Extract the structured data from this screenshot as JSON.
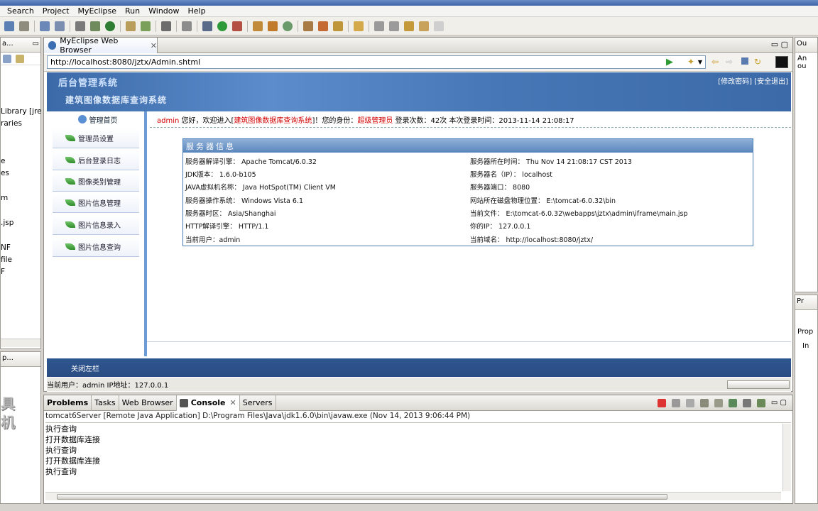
{
  "app": {
    "menu": [
      "Search",
      "Project",
      "MyEclipse",
      "Run",
      "Window",
      "Help"
    ]
  },
  "left_panel": {
    "tab_label": "a...",
    "items": [
      "Library [jre",
      "raries",
      "e",
      "es",
      "m",
      ".jsp",
      "NF",
      "file",
      "F"
    ],
    "bottom_tab_label": "p..."
  },
  "right_panel": {
    "tab1_label": "Ou",
    "tab1_content": "An ou",
    "tab2_label": "Pr",
    "tab2_sub": "Prop",
    "tab2_item": "In"
  },
  "browser": {
    "tab_label": "MyEclipse Web Browser",
    "url": "http://localhost:8080/jztx/Admin.shtml"
  },
  "site": {
    "logo": "后台管理系统",
    "subtitle": "建筑图像数据库查询系统",
    "header_links": "[修改密码] [安全退出]",
    "sidebar_home": "管理首页",
    "menu_items": [
      "管理员设置",
      "后台登录日志",
      "图像类别管理",
      "图片信息管理",
      "图片信息录入",
      "图片信息查询"
    ],
    "welcome": {
      "user": "admin",
      "text1": " 您好，欢迎进入[",
      "system": "建筑图像数据库查询系统",
      "text2": "]！您的身份：",
      "role": "超级管理员",
      "text3": " 登录次数：42次 本次登录时间：2013-11-14 21:08:17"
    },
    "info_title": "服务器信息",
    "info_left": [
      "服务器解译引擎： Apache Tomcat/6.0.32",
      "JDK版本： 1.6.0-b105",
      "JAVA虚拟机名称： Java HotSpot(TM) Client VM",
      "服务器操作系统： Windows Vista 6.1",
      "服务器时区： Asia/Shanghai",
      "HTTP解译引擎： HTTP/1.1",
      "当前用户：admin"
    ],
    "info_right": [
      "服务器所在时间： Thu Nov 14 21:08:17 CST 2013",
      "服务器名（IP）： localhost",
      "服务器端口： 8080",
      "网站所在磁盘物理位置： E:\\tomcat-6.0.32\\bin",
      "当前文件： E:\\tomcat-6.0.32\\webapps\\jztx\\admin\\iframe\\main.jsp",
      "你的IP： 127.0.0.1",
      "当前域名： http://localhost:8080/jztx/"
    ],
    "close_sidebar": "关闭左栏",
    "status_text": "当前用户：admin  IP地址：127.0.0.1"
  },
  "console": {
    "tabs": [
      "Problems",
      "Tasks",
      "Web Browser",
      "Console",
      "Servers"
    ],
    "active_tab": "Console",
    "description": "tomcat6Server [Remote Java Application] D:\\Program Files\\Java\\jdk1.6.0\\bin\\javaw.exe (Nov 14, 2013 9:06:44 PM)",
    "lines": [
      "执行查询",
      "打开数据库连接",
      "执行查询",
      "打开数据库连接",
      "执行查询"
    ]
  },
  "colors": {
    "banner": "#4777b6",
    "accent_red": "#d20000",
    "footer": "#2f5690"
  }
}
